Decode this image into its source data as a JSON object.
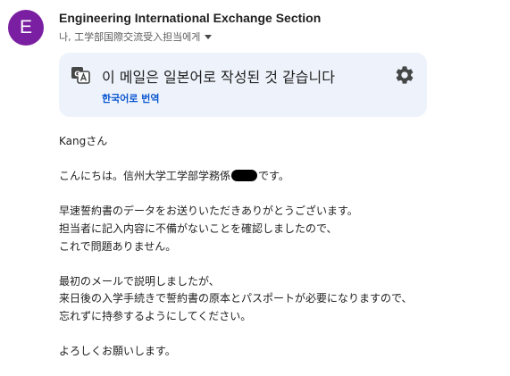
{
  "header": {
    "avatar_letter": "E",
    "avatar_color": "#7b1fa2",
    "sender_name": "Engineering International Exchange Section",
    "recipient_line": "나, 工学部国際交流受入担当에게",
    "details_icon": "chevron-down-icon"
  },
  "translate_banner": {
    "icon": "translate-icon",
    "message": "이 메일은 일본어로 작성된 것 같습니다",
    "translate_link": "한국어로 번역",
    "settings_icon": "gear-icon",
    "link_color": "#0b57d0",
    "background_color": "#eef3fb"
  },
  "body": {
    "greeting": "Kangさん",
    "intro_before": "こんにちは。信州大学工学部学務係",
    "intro_after": "です。",
    "paragraph1": [
      "早速誓約書のデータをお送りいただきありがとうございます。",
      "担当者に記入内容に不備がないことを確認しましたので、",
      "これで問題ありません。"
    ],
    "paragraph2": [
      "最初のメールで説明しましたが、",
      "来日後の入学手続きで誓約書の原本とパスポートが必要になりますので、",
      "忘れずに持参するようにしてください。"
    ],
    "closing": "よろしくお願いします。"
  }
}
